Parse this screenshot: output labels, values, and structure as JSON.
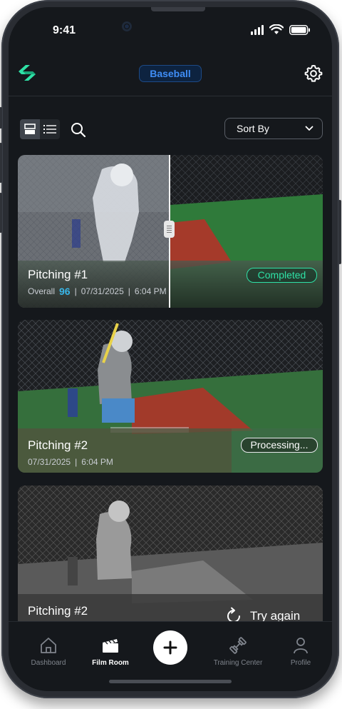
{
  "status_bar": {
    "time": "9:41"
  },
  "header": {
    "sport": "Baseball",
    "icons": [
      "app-logo-icon",
      "settings-gear-icon"
    ]
  },
  "toolbar": {
    "view_modes": [
      "card-view-icon",
      "list-view-icon"
    ],
    "active_view": "card",
    "sort_label": "Sort By"
  },
  "cards": [
    {
      "title": "Pitching #1",
      "overall_label": "Overall",
      "score": "96",
      "date": "07/31/2025",
      "time": "6:04 PM",
      "status": "Completed"
    },
    {
      "title": "Pitching #2",
      "date": "07/31/2025",
      "time": "6:04 PM",
      "status": "Processing..."
    },
    {
      "title": "Pitching #2",
      "action": "Try again"
    }
  ],
  "tabbar": {
    "items": [
      {
        "label": "Dashboard",
        "icon": "home-icon",
        "active": false
      },
      {
        "label": "Film Room",
        "icon": "clapperboard-icon",
        "active": true
      },
      {
        "label": "Training Center",
        "icon": "dumbbell-icon",
        "active": false
      },
      {
        "label": "Profile",
        "icon": "person-icon",
        "active": false
      }
    ],
    "fab_icon": "plus-icon"
  },
  "colors": {
    "accent_green": "#2fe1a6",
    "accent_blue": "#3f8df5",
    "score_blue": "#38b6e8",
    "background": "#15181c"
  }
}
